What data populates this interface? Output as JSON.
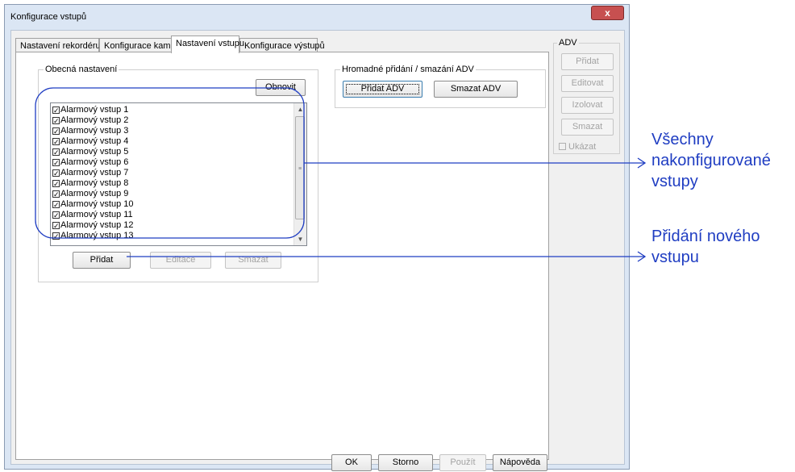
{
  "window": {
    "title": "Konfigurace vstupů",
    "close_label": "x"
  },
  "tabs": [
    {
      "label": "Nastavení rekordéru"
    },
    {
      "label": "Konfigurace kamer"
    },
    {
      "label": "Nastavení vstupu"
    },
    {
      "label": "Konfigurace výstupů"
    }
  ],
  "general": {
    "group_label": "Obecná nastavení",
    "refresh_label": "Obnovit",
    "items": [
      {
        "label": "Alarmový vstup 1",
        "check": "✓"
      },
      {
        "label": "Alarmový vstup 2",
        "check": "✓"
      },
      {
        "label": "Alarmový vstup 3",
        "check": "✓"
      },
      {
        "label": "Alarmový vstup 4",
        "check": "✓"
      },
      {
        "label": "Alarmový vstup 5",
        "check": "✓"
      },
      {
        "label": "Alarmový vstup 6",
        "check": "✓"
      },
      {
        "label": "Alarmový vstup 7",
        "check": "✓"
      },
      {
        "label": "Alarmový vstup 8",
        "check": "✓"
      },
      {
        "label": "Alarmový vstup 9",
        "check": "✓"
      },
      {
        "label": "Alarmový vstup 10",
        "check": "✓"
      },
      {
        "label": "Alarmový vstup 11",
        "check": "✓"
      },
      {
        "label": "Alarmový vstup 12",
        "check": "✓"
      },
      {
        "label": "Alarmový vstup 13",
        "check": "✓"
      }
    ],
    "add_label": "Přidat",
    "edit_label": "Editace",
    "delete_label": "Smazat"
  },
  "bulk": {
    "group_label": "Hromadné přidání / smazání ADV",
    "add_label": "Přidat ADV",
    "delete_label": "Smazat ADV"
  },
  "adv": {
    "group_label": "ADV",
    "add_label": "Přidat",
    "edit_label": "Editovat",
    "isolate_label": "Izolovat",
    "delete_label": "Smazat",
    "show_label": "Ukázat"
  },
  "footer": {
    "ok_label": "OK",
    "cancel_label": "Storno",
    "apply_label": "Použít",
    "help_label": "Nápověda"
  },
  "annotations": {
    "all_inputs": [
      "Všechny",
      "nakonfigurované",
      "vstupy"
    ],
    "add_input": [
      "Přidání nového",
      "vstupu"
    ]
  },
  "colors": {
    "annotation": "#1f3dc2"
  }
}
